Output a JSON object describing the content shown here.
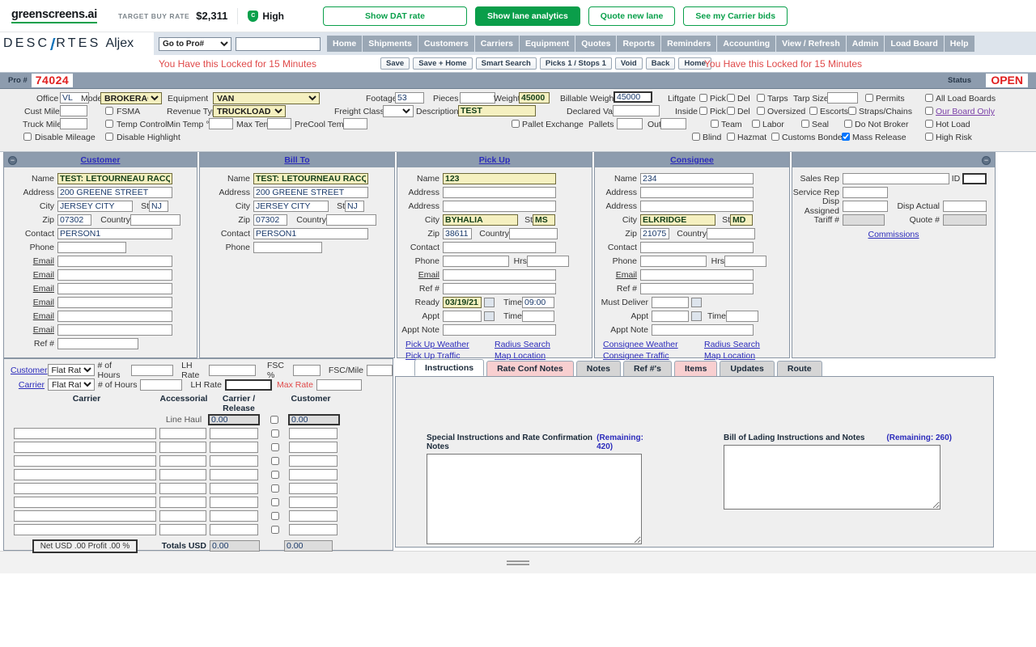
{
  "greenscreens": {
    "logo": "greenscreens.ai",
    "target_label": "TARGET BUY RATE",
    "target_rate": "$2,311",
    "confidence": "High",
    "confidence_badge": "C",
    "buttons": [
      {
        "label": "Show DAT rate",
        "style": "outline"
      },
      {
        "label": "Show lane analytics",
        "style": "primary"
      },
      {
        "label": "Quote new lane",
        "style": "outline"
      },
      {
        "label": "See my Carrier bids",
        "style": "outline"
      }
    ],
    "accent": "#0aa04b"
  },
  "nav": {
    "brand": "DESC",
    "brand2": "RTES",
    "product": "Aljex",
    "goto_label": "Go to Pro#",
    "goto_value": "",
    "search_value": "",
    "items": [
      "Home",
      "Shipments",
      "Customers",
      "Carriers",
      "Equipment",
      "Quotes",
      "Reports",
      "Reminders",
      "Accounting",
      "View / Refresh",
      "Admin",
      "Load Board",
      "Help"
    ]
  },
  "lock": {
    "message_left": "You Have this Locked for 15 Minutes",
    "message_right": "You Have this Locked for 15 Minutes",
    "buttons": [
      "Save",
      "Save + Home",
      "Smart Search",
      "Picks 1 / Stops 1",
      "Void",
      "Back",
      "Home"
    ]
  },
  "probar": {
    "pro_label": "Pro #",
    "pro_number": "74024",
    "status_label": "Status",
    "status_value": "OPEN"
  },
  "detail": {
    "office_label": "Office",
    "office_value": "VL",
    "mode_label": "Mode",
    "mode_value": "BROKERAGE",
    "equipment_label": "Equipment",
    "equipment_value": "VAN",
    "footage_label": "Footage",
    "footage_value": "53",
    "pieces_label": "Pieces",
    "pieces_value": "",
    "weight_label": "Weight",
    "weight_value": "45000",
    "billable_weight_label": "Billable Weight",
    "billable_weight_value": "45000",
    "cust_miles_label": "Cust Miles",
    "cust_miles_value": "",
    "fsma_label": "FSMA",
    "revenue_type_label": "Revenue Type",
    "revenue_type_value": "TRUCKLOAD",
    "freight_class_label": "Freight Class",
    "freight_class_value": "",
    "description_label": "Description",
    "description_value": "TEST",
    "declared_value_label": "Declared Value",
    "declared_value_value": "",
    "truck_miles_label": "Truck Miles",
    "truck_miles_value": "",
    "temp_control_label": "Temp Control",
    "min_temp_label": "Min Temp °F",
    "min_temp_value": "",
    "max_temp_label": "Max Temp",
    "max_temp_value": "",
    "precool_label": "PreCool Temp",
    "precool_value": "",
    "pallet_exchange_label": "Pallet Exchange",
    "pallets_in_label": "Pallets In",
    "pallets_in_value": "",
    "pallets_out_label": "Out",
    "pallets_out_value": "",
    "disable_mileage_label": "Disable Mileage",
    "disable_highlight_label": "Disable Highlight",
    "liftgate_label": "Liftgate",
    "liftgate_pick_label": "Pick",
    "liftgate_del_label": "Del",
    "inside_label": "Inside",
    "inside_pick_label": "Pick",
    "inside_del_label": "Del",
    "tarps_label": "Tarps",
    "tarp_size_label": "Tarp Size",
    "tarp_size_value": "",
    "permits_label": "Permits",
    "oversized_label": "Oversized",
    "escorts_label": "Escorts",
    "straps_label": "Straps/Chains",
    "team_label": "Team",
    "labor_label": "Labor",
    "seal_label": "Seal",
    "do_not_broker_label": "Do Not Broker",
    "blind_label": "Blind",
    "hazmat_label": "Hazmat",
    "customs_bonded_label": "Customs Bonded",
    "mass_release_label": "Mass Release",
    "all_load_boards_label": "All Load Boards",
    "our_board_only_label": "Our Board Only",
    "hot_load_label": "Hot Load",
    "high_risk_label": "High Risk"
  },
  "customer": {
    "title": "Customer",
    "labels": {
      "name": "Name",
      "address": "Address",
      "city": "City",
      "st": "St",
      "zip": "Zip",
      "country": "Country",
      "contact": "Contact",
      "phone": "Phone",
      "email": "Email",
      "ref": "Ref #"
    },
    "name": "TEST: LETOURNEAU RACQU",
    "address": "200 GREENE STREET",
    "city": "JERSEY CITY",
    "st": "NJ",
    "zip": "07302",
    "country": "",
    "contact": "PERSON1",
    "phone": "",
    "emails": [
      "",
      "",
      "",
      "",
      "",
      ""
    ],
    "ref": ""
  },
  "billto": {
    "title": "Bill To",
    "labels": {
      "name": "Name",
      "address": "Address",
      "city": "City",
      "st": "St",
      "zip": "Zip",
      "country": "Country",
      "contact": "Contact",
      "phone": "Phone"
    },
    "name": "TEST: LETOURNEAU RACQU",
    "address": "200 GREENE STREET",
    "city": "JERSEY CITY",
    "st": "NJ",
    "zip": "07302",
    "country": "",
    "contact": "PERSON1",
    "phone": ""
  },
  "pickup": {
    "title": "Pick Up",
    "labels": {
      "name": "Name",
      "address": "Address",
      "address2": "Address",
      "city": "City",
      "st": "St",
      "zip": "Zip",
      "country": "Country",
      "contact": "Contact",
      "phone": "Phone",
      "hrs": "Hrs",
      "email": "Email",
      "ref": "Ref #",
      "ready": "Ready",
      "time": "Time",
      "appt": "Appt",
      "appt_time": "Time",
      "appt_note": "Appt Note"
    },
    "name": "123",
    "address": "",
    "address2": "",
    "city": "BYHALIA",
    "st": "MS",
    "zip": "38611",
    "country": "",
    "contact": "",
    "phone": "",
    "hrs": "",
    "email": "",
    "ref": "",
    "ready": "03/19/21",
    "ready_time": "09:00",
    "appt": "",
    "appt_time": "",
    "appt_note": "",
    "links": [
      "Pick Up Weather",
      "Radius Search",
      "Pick Up Traffic",
      "Map Location"
    ]
  },
  "consignee": {
    "title": "Consignee",
    "labels": {
      "name": "Name",
      "address": "Address",
      "address2": "Address",
      "city": "City",
      "st": "St",
      "zip": "Zip",
      "country": "Country",
      "contact": "Contact",
      "phone": "Phone",
      "hrs": "Hrs",
      "email": "Email",
      "ref": "Ref #",
      "must_deliver": "Must Deliver",
      "appt": "Appt",
      "appt_time": "Time",
      "appt_note": "Appt Note"
    },
    "name": "234",
    "address": "",
    "address2": "",
    "city": "ELKRIDGE",
    "st": "MD",
    "zip": "21075",
    "country": "",
    "contact": "",
    "phone": "",
    "hrs": "",
    "email": "",
    "ref": "",
    "must_deliver": "",
    "appt": "",
    "appt_time": "",
    "appt_note": "",
    "links": [
      "Consignee Weather",
      "Radius Search",
      "Consignee Traffic",
      "Map Location"
    ]
  },
  "reps": {
    "sales_rep_label": "Sales Rep",
    "sales_rep_value": "",
    "id_label": "ID",
    "id_value": "",
    "service_rep_label": "Service Rep",
    "service_rep_value": "",
    "disp_assigned_label": "Disp Assigned",
    "disp_assigned_value": "",
    "disp_actual_label": "Disp Actual",
    "disp_actual_value": "",
    "tariff_label": "Tariff #",
    "tariff_value": "",
    "quote_label": "Quote #",
    "quote_value": "",
    "commissions_link": "Commissions"
  },
  "rates": {
    "customer_link": "Customer",
    "carrier_link": "Carrier",
    "customer_rate_type": "Flat Rate",
    "carrier_rate_type": "Flat Rate",
    "hours_label": "# of Hours",
    "customer_hours": "",
    "carrier_hours": "",
    "lh_rate_label": "LH Rate",
    "customer_lh_rate": "",
    "carrier_lh_rate": "",
    "fsc_pct_label": "FSC %",
    "fsc_pct_value": "",
    "fsc_mile_label": "FSC/Mile",
    "fsc_mile_value": "",
    "max_rate_label": "Max Rate",
    "max_rate_value": "",
    "columns": [
      "Carrier",
      "Accessorial",
      "Carrier / Release",
      "Customer"
    ],
    "line_haul_label": "Line Haul",
    "line_haul_carrier": "0.00",
    "line_haul_customer": "0.00",
    "rows": [
      {
        "carrier": "",
        "accessorial": "",
        "release": "",
        "customer": "",
        "checked": false
      },
      {
        "carrier": "",
        "accessorial": "",
        "release": "",
        "customer": "",
        "checked": false
      },
      {
        "carrier": "",
        "accessorial": "",
        "release": "",
        "customer": "",
        "checked": false
      },
      {
        "carrier": "",
        "accessorial": "",
        "release": "",
        "customer": "",
        "checked": false
      },
      {
        "carrier": "",
        "accessorial": "",
        "release": "",
        "customer": "",
        "checked": false
      },
      {
        "carrier": "",
        "accessorial": "",
        "release": "",
        "customer": "",
        "checked": false
      },
      {
        "carrier": "",
        "accessorial": "",
        "release": "",
        "customer": "",
        "checked": false
      },
      {
        "carrier": "",
        "accessorial": "",
        "release": "",
        "customer": "",
        "checked": false
      }
    ],
    "net_profit_label": "Net USD .00   Profit .00 %",
    "totals_label": "Totals USD",
    "totals_carrier": "0.00",
    "totals_customer": "0.00"
  },
  "tabs": {
    "items": [
      {
        "label": "Instructions",
        "state": "active"
      },
      {
        "label": "Rate Conf Notes",
        "state": "pink"
      },
      {
        "label": "Notes",
        "state": "normal"
      },
      {
        "label": "Ref #'s",
        "state": "normal"
      },
      {
        "label": "Items",
        "state": "pink"
      },
      {
        "label": "Updates",
        "state": "normal"
      },
      {
        "label": "Route",
        "state": "normal"
      }
    ],
    "instructions": {
      "special_label": "Special Instructions and Rate Confirmation Notes",
      "special_remaining": "(Remaining: 420)",
      "special_value": "",
      "bol_label": "Bill of Lading Instructions and Notes",
      "bol_remaining": "(Remaining: 260)",
      "bol_value": ""
    }
  }
}
